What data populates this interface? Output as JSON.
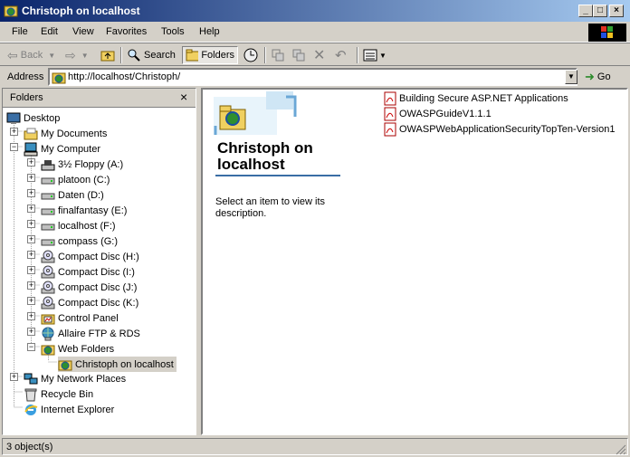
{
  "window": {
    "title": "Christoph on localhost"
  },
  "menu": [
    "File",
    "Edit",
    "View",
    "Favorites",
    "Tools",
    "Help"
  ],
  "toolbar": {
    "back": "Back",
    "search": "Search",
    "folders": "Folders"
  },
  "address": {
    "label": "Address",
    "value": "http://localhost/Christoph/",
    "go": "Go"
  },
  "folders_pane": {
    "title": "Folders",
    "tree": [
      {
        "label": "Desktop",
        "icon": "desktop-icon"
      },
      {
        "label": "My Documents",
        "icon": "folder-icon"
      },
      {
        "label": "My Computer",
        "icon": "computer-icon"
      },
      {
        "label": "3½ Floppy (A:)",
        "icon": "floppy-icon"
      },
      {
        "label": "platoon (C:)",
        "icon": "drive-icon"
      },
      {
        "label": "Daten (D:)",
        "icon": "drive-icon"
      },
      {
        "label": "finalfantasy (E:)",
        "icon": "drive-icon"
      },
      {
        "label": "localhost (F:)",
        "icon": "drive-icon"
      },
      {
        "label": "compass (G:)",
        "icon": "drive-icon"
      },
      {
        "label": "Compact Disc (H:)",
        "icon": "cd-icon"
      },
      {
        "label": "Compact Disc (I:)",
        "icon": "cd-icon"
      },
      {
        "label": "Compact Disc (J:)",
        "icon": "cd-icon"
      },
      {
        "label": "Compact Disc (K:)",
        "icon": "cd-icon"
      },
      {
        "label": "Control Panel",
        "icon": "control-panel-icon"
      },
      {
        "label": "Allaire FTP & RDS",
        "icon": "ftp-icon"
      },
      {
        "label": "Web Folders",
        "icon": "web-folders-icon"
      },
      {
        "label": "Christoph on localhost",
        "icon": "web-folder-icon"
      },
      {
        "label": "My Network Places",
        "icon": "network-icon"
      },
      {
        "label": "Recycle Bin",
        "icon": "recycle-bin-icon"
      },
      {
        "label": "Internet Explorer",
        "icon": "ie-icon"
      }
    ]
  },
  "content": {
    "title": "Christoph on localhost",
    "description": "Select an item to view its description.",
    "files": [
      "Building Secure ASP.NET Applications",
      "OWASPGuideV1.1.1",
      "OWASPWebApplicationSecurityTopTen-Version1"
    ]
  },
  "status": {
    "text": "3 object(s)"
  }
}
